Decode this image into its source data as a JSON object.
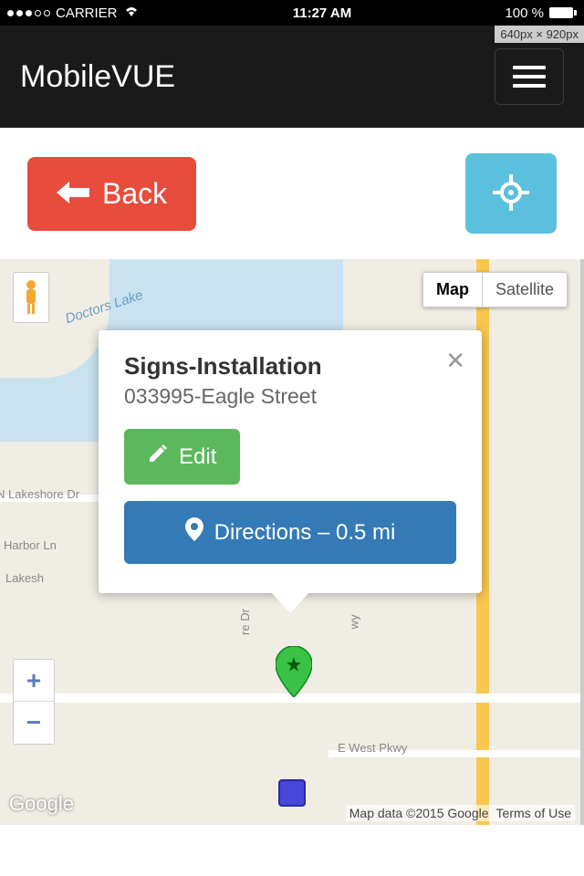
{
  "status": {
    "carrier": "CARRIER",
    "time": "11:27 AM",
    "battery": "100 %"
  },
  "dim_badge": "640px × 920px",
  "app": {
    "title": "MobileVUE"
  },
  "toolbar": {
    "back": "Back"
  },
  "map": {
    "type_map": "Map",
    "type_satellite": "Satellite",
    "attribution": "Map data ©2015 Google",
    "terms": "Terms of Use",
    "logo": "Google",
    "labels": {
      "doctors_lake": "Doctors Lake",
      "n_lakeshore": "N Lakeshore Dr",
      "harbor": "Harbor Ln",
      "lakesh": "Lakesh",
      "re_dr": "re Dr",
      "wy": "wy",
      "e_west": "E West Pkwy"
    }
  },
  "info": {
    "title": "Signs-Installation",
    "subtitle": "033995-Eagle Street",
    "edit": "Edit",
    "directions": "Directions – 0.5 mi"
  }
}
